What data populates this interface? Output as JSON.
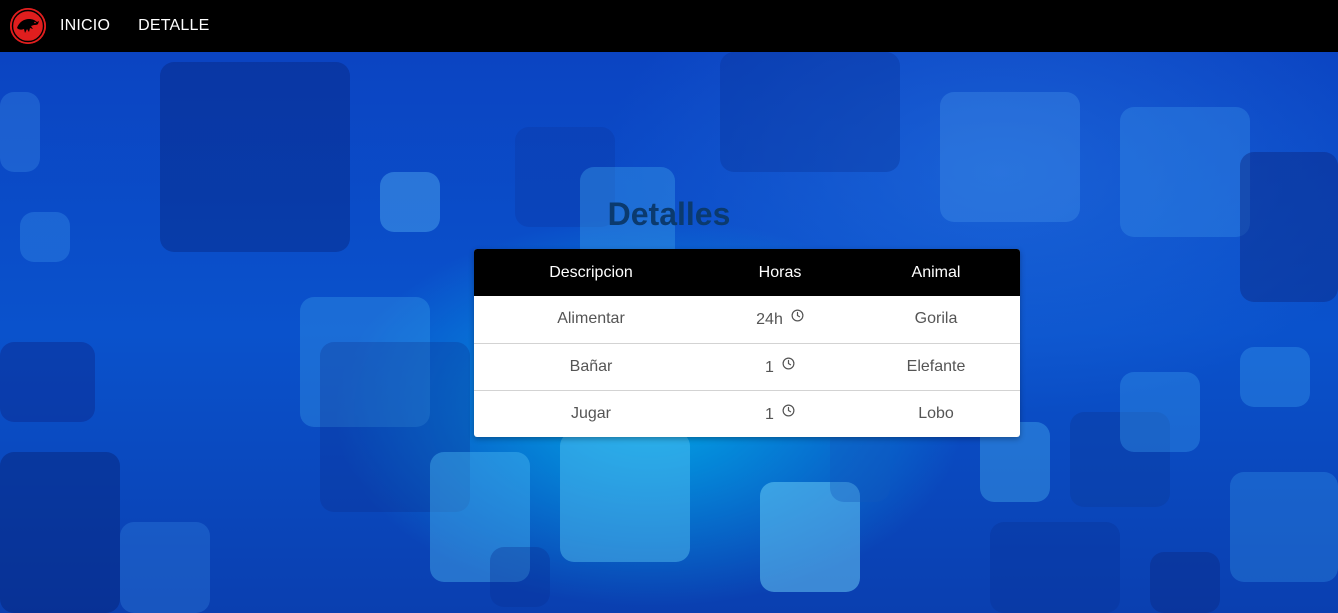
{
  "nav": {
    "logo_icon": "jurassic-dinosaur-logo-icon",
    "links": [
      {
        "label": "INICIO"
      },
      {
        "label": "DETALLE"
      }
    ]
  },
  "page": {
    "title": "Detalles"
  },
  "table": {
    "headers": [
      "Descripcion",
      "Horas",
      "Animal"
    ],
    "rows": [
      {
        "descripcion": "Alimentar",
        "horas": "24h",
        "animal": "Gorila"
      },
      {
        "descripcion": "Bañar",
        "horas": "1",
        "animal": "Elefante"
      },
      {
        "descripcion": "Jugar",
        "horas": "1",
        "animal": "Lobo"
      }
    ],
    "hours_icon": "clock-icon"
  },
  "colors": {
    "navbar": "#000000",
    "accent_logo": "#e01e1e",
    "title": "#0b3a6e",
    "background": "#0a3fb8"
  }
}
